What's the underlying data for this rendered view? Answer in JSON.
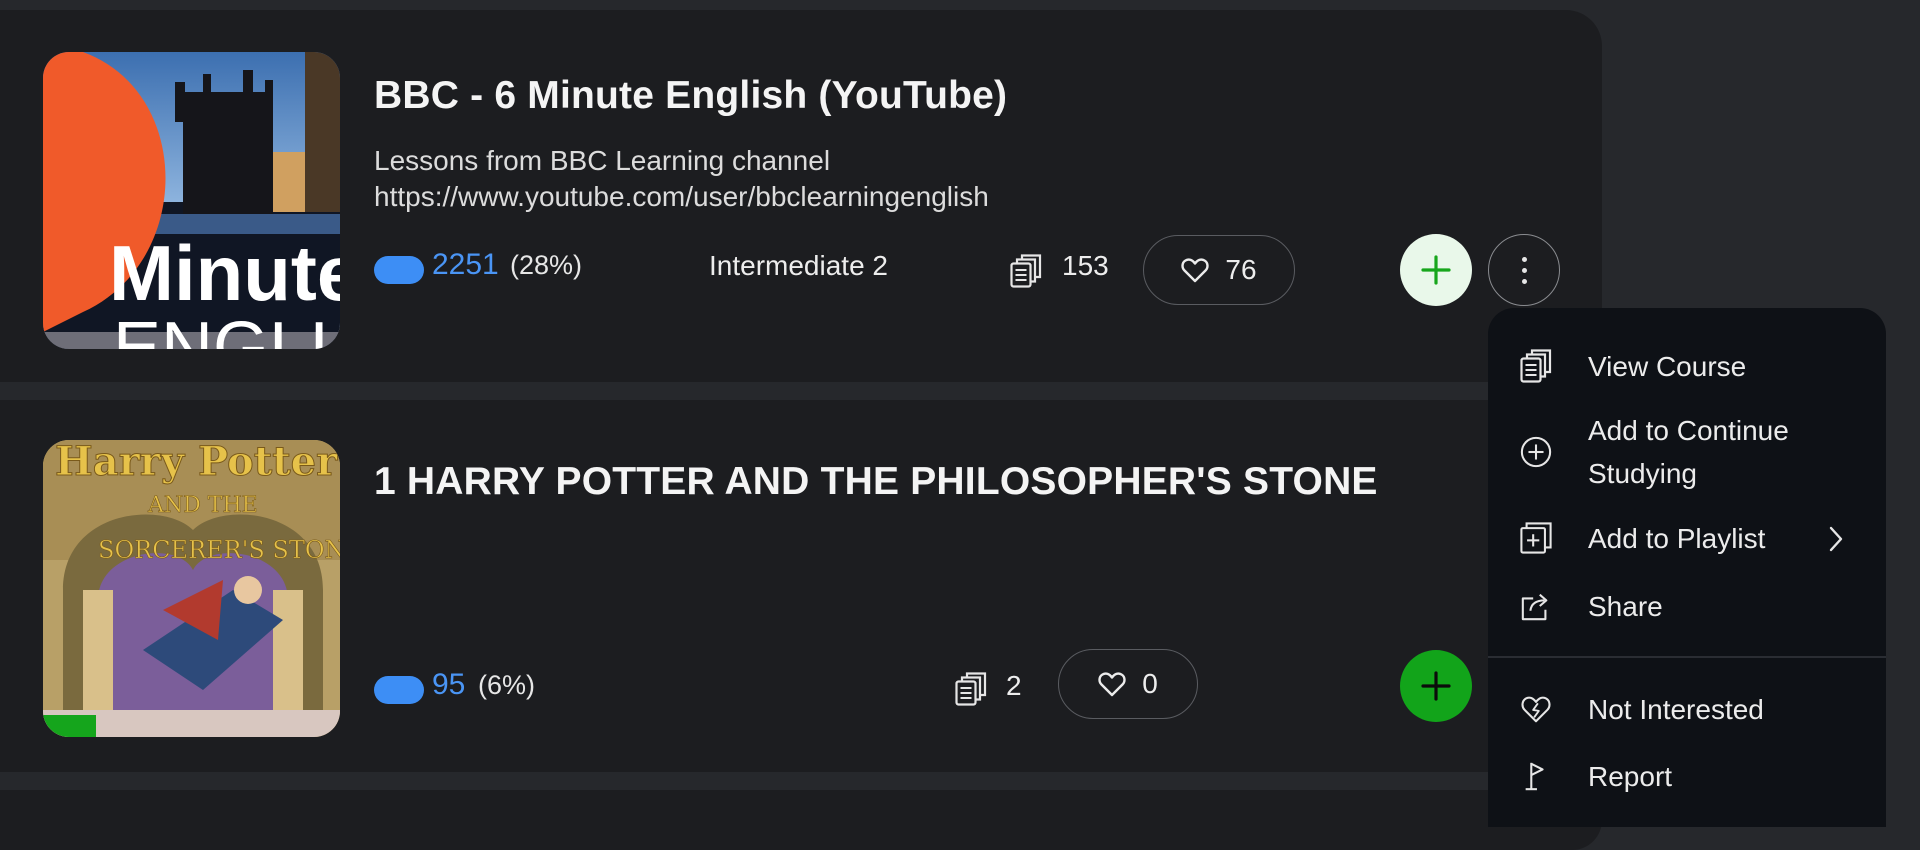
{
  "courses": [
    {
      "title": "BBC - 6 Minute English (YouTube)",
      "description_line1": "Lessons from BBC Learning channel",
      "description_line2": "https://www.youtube.com/user/bbclearningenglish",
      "words": "2251",
      "percent": "(28%)",
      "level": "Intermediate 2",
      "lessons": "153",
      "likes": "76",
      "thumb_text_1": "Minute",
      "thumb_text_2": "ENGLI"
    },
    {
      "title": "1 HARRY POTTER AND THE PHILOSOPHER'S STONE",
      "words": "95",
      "percent": "(6%)",
      "lessons": "2",
      "likes": "0",
      "progress": 0.18,
      "thumb_text_1": "Harry Potter",
      "thumb_text_2": "AND THE",
      "thumb_text_3": "SORCERER'S STONE"
    }
  ],
  "menu": {
    "items": [
      {
        "label": "View Course",
        "icon": "lessons-icon"
      },
      {
        "label": "Add to Continue Studying",
        "icon": "plus-circle-icon"
      },
      {
        "label": "Add to Playlist",
        "icon": "playlist-add-icon"
      },
      {
        "label": "Share",
        "icon": "share-icon"
      },
      {
        "label": "Not Interested",
        "icon": "heart-off-icon"
      },
      {
        "label": "Report",
        "icon": "flag-icon"
      }
    ]
  },
  "colors": {
    "accent_blue": "#3d8ef5",
    "add_green": "#12a41a",
    "card_bg": "#1c1d20",
    "page_bg": "#26282c",
    "menu_bg": "#0e1116"
  }
}
